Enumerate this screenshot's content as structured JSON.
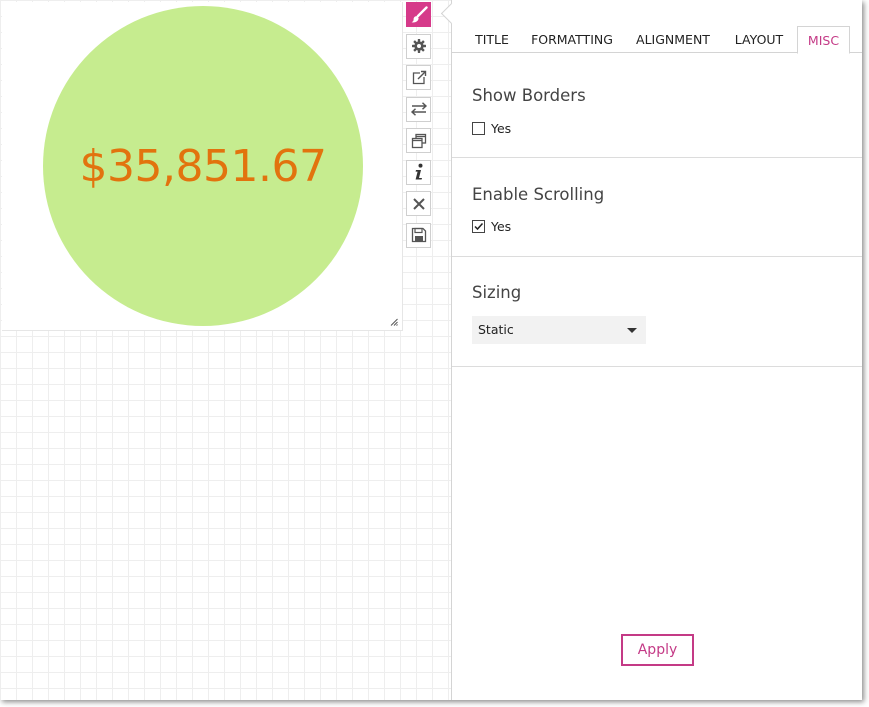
{
  "widget": {
    "kpi_value": "$35,851.67",
    "circle_color": "#c6ec8f",
    "value_color": "#e2730e"
  },
  "toolbar": {
    "items": [
      {
        "icon": "paintbrush-icon",
        "active": true
      },
      {
        "icon": "gear-icon"
      },
      {
        "icon": "external-link-icon"
      },
      {
        "icon": "swap-arrows-icon"
      },
      {
        "icon": "duplicate-icon"
      },
      {
        "icon": "info-icon"
      },
      {
        "icon": "close-icon"
      },
      {
        "icon": "save-icon"
      }
    ],
    "accent": "#d63a8a"
  },
  "tabs": [
    {
      "label": "TITLE"
    },
    {
      "label": "FORMATTING"
    },
    {
      "label": "ALIGNMENT"
    },
    {
      "label": "LAYOUT"
    },
    {
      "label": "MISC",
      "active": true
    }
  ],
  "misc": {
    "show_borders": {
      "title": "Show Borders",
      "option_label": "Yes",
      "checked": false
    },
    "enable_scrolling": {
      "title": "Enable Scrolling",
      "option_label": "Yes",
      "checked": true
    },
    "sizing": {
      "title": "Sizing",
      "selected": "Static"
    }
  },
  "apply_label": "Apply",
  "accent_color": "#c43a86"
}
